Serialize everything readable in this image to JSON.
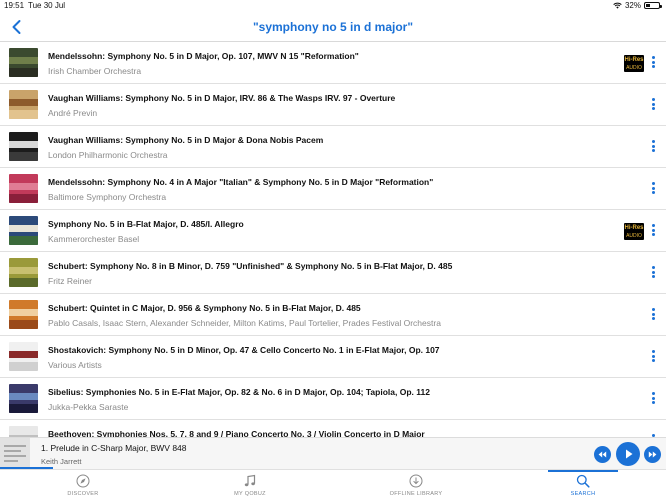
{
  "status": {
    "time": "19:51",
    "date": "Tue 30 Jul",
    "battery": "32%",
    "battery_level": 0.32
  },
  "nav": {
    "title": "\"symphony no 5 in d major\"",
    "back_icon": "chevron-left-icon"
  },
  "results": [
    {
      "title": "Mendelssohn: Symphony No. 5 in D Major, Op. 107, MWV N 15 \"Reformation\"",
      "artist": "Irish Chamber Orchestra",
      "hires": true,
      "cover": [
        "#3b4a2f",
        "#6f7f4a",
        "#2a2e22"
      ]
    },
    {
      "title": "Vaughan Williams: Symphony No. 5 in D Major, IRV. 86 & The Wasps IRV. 97 - Overture",
      "artist": "André Previn",
      "hires": false,
      "cover": [
        "#c9a36a",
        "#8d5a2b",
        "#e2c38e"
      ]
    },
    {
      "title": "Vaughan Williams: Symphony No. 5 in D Major & Dona Nobis Pacem",
      "artist": "London Philharmonic Orchestra",
      "hires": false,
      "cover": [
        "#1c1c1c",
        "#d8d8d8",
        "#3a3a3a"
      ]
    },
    {
      "title": "Mendelssohn: Symphony No. 4 in A Major \"Italian\" & Symphony No. 5 in D Major \"Reformation\"",
      "artist": "Baltimore Symphony Orchestra",
      "hires": false,
      "cover": [
        "#c23a5a",
        "#e07d94",
        "#8a1f3a"
      ]
    },
    {
      "title": "Symphony No. 5 in B-Flat Major, D. 485/I. Allegro",
      "artist": "Kammerorchester Basel",
      "hires": true,
      "cover": [
        "#2c4a7a",
        "#e8e4d8",
        "#3b6a3b"
      ]
    },
    {
      "title": "Schubert: Symphony No. 8 in B Minor, D. 759 \"Unfinished\" & Symphony No. 5 in B-Flat Major, D. 485",
      "artist": "Fritz Reiner",
      "hires": false,
      "cover": [
        "#9a9a3a",
        "#c8c070",
        "#5a6a2a"
      ]
    },
    {
      "title": "Schubert: Quintet in C Major, D. 956 & Symphony No. 5 in B-Flat Major, D. 485",
      "artist": "Pablo Casals, Isaac Stern, Alexander Schneider, Milton Katims, Paul Tortelier, Prades Festival Orchestra",
      "hires": false,
      "cover": [
        "#d07a2a",
        "#f0d0a0",
        "#9a4a1a"
      ]
    },
    {
      "title": "Shostakovich: Symphony No. 5 in D Minor, Op. 47 & Cello Concerto No. 1 in E-Flat Major, Op. 107",
      "artist": "Various Artists",
      "hires": false,
      "cover": [
        "#f0f0f0",
        "#8a2a2a",
        "#d0d0d0"
      ]
    },
    {
      "title": "Sibelius: Symphonies No. 5 in E-Flat Major, Op. 82 & No. 6 in D Major, Op. 104; Tapiola, Op. 112",
      "artist": "Jukka-Pekka Saraste",
      "hires": false,
      "cover": [
        "#3a3a6a",
        "#6a8ac0",
        "#1a1a3a"
      ]
    },
    {
      "title": "Beethoven: Symphonies Nos. 5, 7, 8 and 9 / Piano Concerto No. 3 / Violin Concerto in D Major",
      "artist": "",
      "hires": false,
      "cover": [
        "#e8e8e8",
        "#c0c0c0",
        "#f4f4f4"
      ]
    }
  ],
  "hires_badge": {
    "line1": "Hi-Res",
    "line2": "AUDIO"
  },
  "player": {
    "track": "1. Prelude in C-Sharp Major, BWV 848",
    "artist": "Keith Jarrett",
    "progress": 0.08
  },
  "tabs": [
    {
      "label": "DISCOVER",
      "icon": "compass-icon",
      "active": false
    },
    {
      "label": "MY QOBUZ",
      "icon": "music-note-icon",
      "active": false
    },
    {
      "label": "OFFLINE LIBRARY",
      "icon": "download-icon",
      "active": false
    },
    {
      "label": "SEARCH",
      "icon": "search-icon",
      "active": true
    }
  ],
  "colors": {
    "accent": "#1b71d6",
    "hires_gold": "#e4b43a"
  }
}
